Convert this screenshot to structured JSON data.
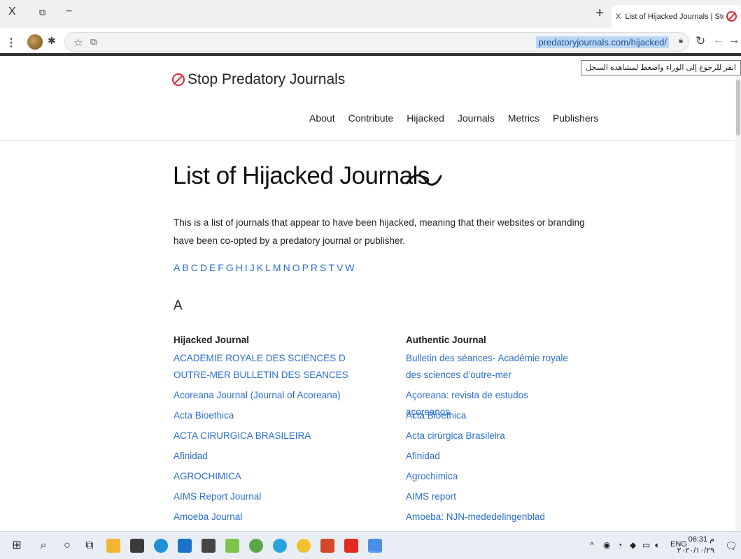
{
  "browser": {
    "tab": {
      "title": "List of Hijacked Journals | Stop Pr",
      "close": "X"
    },
    "new_tab": "+",
    "window_controls": {
      "close": "X",
      "restore": "⧉",
      "minimize": "−"
    },
    "url": "predatoryjournals.com/hijacked/",
    "tooltip": "انقر للرجوع إلى الوراء واضغط لمشاهدة السجل"
  },
  "site": {
    "logo_text": "Stop Predatory Journals",
    "nav": [
      "About",
      "Contribute",
      "Hijacked",
      "Journals",
      "Metrics",
      "Publishers"
    ]
  },
  "main": {
    "title": "List of Hijacked Journals",
    "intro": "This is a list of journals that appear to have been hijacked, meaning that their websites or branding have been co-opted by a predatory journal or publisher.",
    "alphabet": [
      "A",
      "B",
      "C",
      "D",
      "E",
      "F",
      "G",
      "H",
      "I",
      "J",
      "K",
      "L",
      "M",
      "N",
      "O",
      "P",
      "R",
      "S",
      "T",
      "V",
      "W"
    ],
    "section_letter": "A",
    "hijacked_header": "Hijacked Journal",
    "authentic_header": "Authentic Journal",
    "rows": [
      {
        "hijacked": "ACADEMIE ROYALE DES SCIENCES D OUTRE-MER BULLETIN DES SEANCES",
        "authentic": "Bulletin des séances- Académie royale des sciences d’outre-mer"
      },
      {
        "hijacked": "Acoreana Journal (Journal of Acoreana)",
        "authentic": "Açoreana: revista de estudos açoreanos"
      },
      {
        "hijacked": "Acta Bioethica",
        "authentic": "Acta Bioethica"
      },
      {
        "hijacked": "ACTA CIRURGICA BRASILEIRA",
        "authentic": "Acta cirúrgica Brasileira"
      },
      {
        "hijacked": "Afinidad",
        "authentic": "Afinidad"
      },
      {
        "hijacked": "AGROCHIMICA",
        "authentic": "Agrochimica"
      },
      {
        "hijacked": "AIMS Report Journal",
        "authentic": "AIMS report"
      },
      {
        "hijacked": "Amoeba Journal",
        "authentic": "Amoeba: NJN-mededelingenblad"
      }
    ]
  },
  "taskbar": {
    "language": "ENG",
    "time": "06:31 م",
    "date": "٢٠٢٠/١٠/٢٩"
  }
}
